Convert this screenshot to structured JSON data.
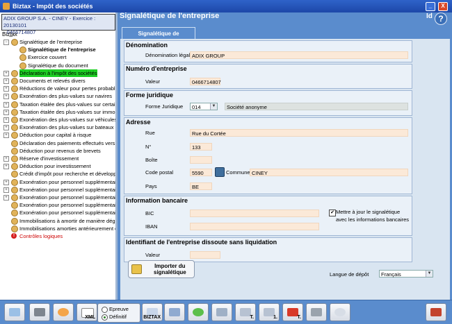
{
  "window": {
    "title": "Biztax - Impôt des sociétés",
    "minimize": "_",
    "close": "X"
  },
  "company": {
    "line1": "ADIX GROUP S.A.   - CINEY - Exercice : 20130101",
    "line2": "  - 0466714807"
  },
  "tree_label": "Bizt̲ax",
  "tree": [
    {
      "label": "Signalétique de l'entreprise",
      "toggle": "−",
      "level": 0
    },
    {
      "label": "Signalétique de l'entreprise",
      "toggle": "",
      "level": 1,
      "selected": true
    },
    {
      "label": "Exercice couvert",
      "toggle": "",
      "level": 1
    },
    {
      "label": "Signalétique du document",
      "toggle": "",
      "level": 1
    },
    {
      "label": "Déclaration à l'impôt des sociétés",
      "toggle": "+",
      "level": 0,
      "highlight": true
    },
    {
      "label": "Documents et relevés divers",
      "toggle": "+",
      "level": 0
    },
    {
      "label": "Réductions de valeur pour pertes probables",
      "toggle": "+",
      "level": 0
    },
    {
      "label": "Exonération des plus-values sur navires",
      "toggle": "+",
      "level": 0
    },
    {
      "label": "Taxation étalée des plus-values sur certains",
      "toggle": "+",
      "level": 0
    },
    {
      "label": "Taxation étalée des plus-values sur immobilis",
      "toggle": "+",
      "level": 0
    },
    {
      "label": "Exonération des plus-values sur véhicules d'",
      "toggle": "+",
      "level": 0
    },
    {
      "label": "Exonération des plus-values sur bateaux de",
      "toggle": "+",
      "level": 0
    },
    {
      "label": "Déduction pour capital à risque",
      "toggle": "+",
      "level": 0
    },
    {
      "label": "Déclaration des paiements effectués vers de",
      "toggle": "",
      "level": 0
    },
    {
      "label": "Déduction pour revenus de brevets",
      "toggle": "",
      "level": 0
    },
    {
      "label": "Réserve d'investissement",
      "toggle": "+",
      "level": 0
    },
    {
      "label": "Déduction pour investissement",
      "toggle": "+",
      "level": 0
    },
    {
      "label": "Crédit d'impôt pour recherche et développem",
      "toggle": "",
      "level": 0
    },
    {
      "label": "Exonération pour personnel supplémentaire",
      "toggle": "+",
      "level": 0
    },
    {
      "label": "Exonération pour personnel supplémentaire a",
      "toggle": "+",
      "level": 0
    },
    {
      "label": "Exonération pour personnel supplémentaire a",
      "toggle": "+",
      "level": 0
    },
    {
      "label": "Exonération pour personnel supplémentaire a",
      "toggle": "",
      "level": 0
    },
    {
      "label": "Exonération pour personnel supplémentaire a",
      "toggle": "",
      "level": 0
    },
    {
      "label": "Immobilisations à amortir de manière dégress",
      "toggle": "",
      "level": 0
    },
    {
      "label": "Immobilisations amorties antérieurement de m",
      "toggle": "",
      "level": 0
    },
    {
      "label": "Contrôles logiques",
      "toggle": "",
      "level": 0,
      "error": true
    }
  ],
  "header": {
    "title": "Signalétique de l'entreprise",
    "id_label": "Id",
    "help": "?"
  },
  "tab": {
    "label": "Signalétique de l'entreprise"
  },
  "denomination": {
    "title": "Dénomination",
    "label": "Dénomination légale",
    "value": "ADIX GROUP"
  },
  "numero": {
    "title": "Numéro d'entreprise",
    "label": "Valeur",
    "value": "0466714807"
  },
  "forme": {
    "title": "Forme juridique",
    "label": "Forme Juridique",
    "code": "014",
    "desc": "Société anonyme"
  },
  "adresse": {
    "title": "Adresse",
    "rue_label": "Rue",
    "rue": "Rue du Cortée",
    "n_label": "N°",
    "n": "133",
    "boite_label": "Boîte",
    "boite": "",
    "cp_label": "Code postal",
    "cp": "5590",
    "commune_label": "Commune",
    "commune": "CINEY",
    "pays_label": "Pays",
    "pays": "BE"
  },
  "bancaire": {
    "title": "Information bancaire",
    "bic_label": "BIC",
    "bic": "",
    "iban_label": "IBAN",
    "iban": "",
    "checkbox_checked": true,
    "checkbox_text1": "Mettre à jour le signalétique",
    "checkbox_text2": "avec les informations bancaires"
  },
  "dissoute": {
    "title": "Identifiant de l'entreprise dissoute sans liquidation",
    "label": "Valeur",
    "value": ""
  },
  "import_button": {
    "line1": "Importer du",
    "line2": "signalétique"
  },
  "langue": {
    "label": "Langue de dépôt",
    "value": "Français"
  },
  "bottombar": {
    "radio1": "Epreuve",
    "radio2": "Définitif",
    "radio_selected": "Définitif",
    "biztax_label": "BIZTAX",
    "xml_label": "XML",
    "one_label": "1.",
    "t_label": "T."
  }
}
